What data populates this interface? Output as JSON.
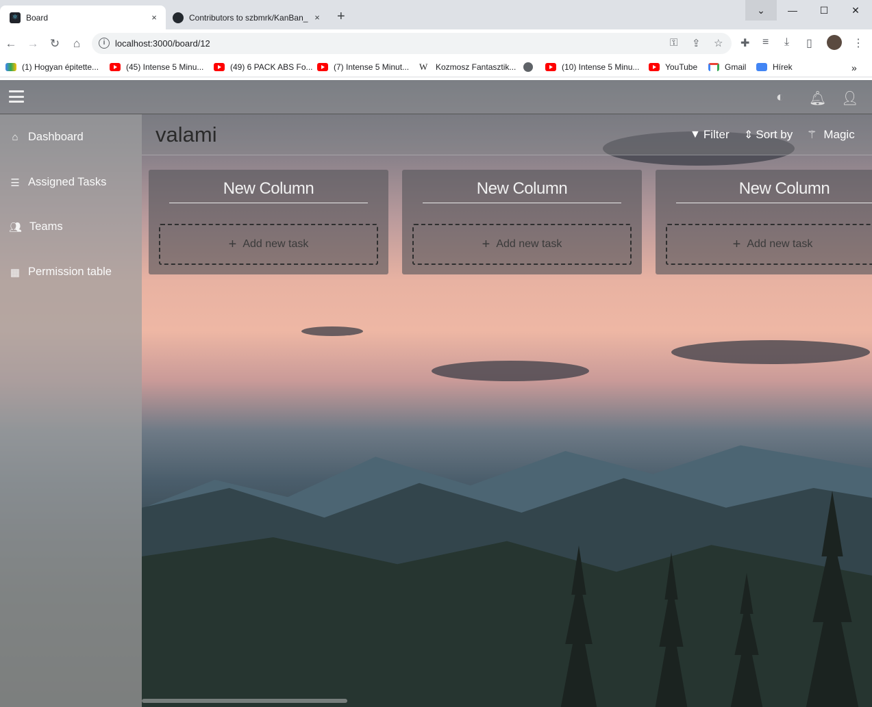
{
  "browser": {
    "tabs": [
      {
        "title": "Board",
        "close": "×"
      },
      {
        "title": "Contributors to szbmrk/KanBan_",
        "close": "×"
      }
    ],
    "new_tab": "+",
    "window_controls": {
      "dropdown": "⌄",
      "minimize": "—",
      "maximize": "☐",
      "close": "✕"
    },
    "url": "localhost:3000/board/12",
    "bookmarks": [
      {
        "label": "(1) Hogyan épitette...",
        "icon": "multicolor-icon"
      },
      {
        "label": "(45) Intense 5 Minu...",
        "icon": "youtube-icon"
      },
      {
        "label": "(49) 6 PACK ABS Fo...",
        "icon": "youtube-icon"
      },
      {
        "label": "(7) Intense 5 Minut...",
        "icon": "youtube-icon"
      },
      {
        "label": "Kozmosz Fantasztik...",
        "icon": "wikipedia-icon"
      },
      {
        "label": "",
        "icon": "globe-icon"
      },
      {
        "label": "(10) Intense 5 Minu...",
        "icon": "youtube-icon"
      },
      {
        "label": "YouTube",
        "icon": "youtube-icon"
      },
      {
        "label": "Gmail",
        "icon": "gmail-icon"
      },
      {
        "label": "Hírek",
        "icon": "google-news-icon"
      }
    ],
    "bookmarks_overflow": "»"
  },
  "sidebar": {
    "items": [
      {
        "label": "Dashboard",
        "icon": "home-icon"
      },
      {
        "label": "Assigned Tasks",
        "icon": "task-list-icon"
      },
      {
        "label": "Teams",
        "icon": "users-icon"
      },
      {
        "label": "Permission table",
        "icon": "table-icon"
      }
    ]
  },
  "board": {
    "title": "valami",
    "actions": {
      "filter": "Filter",
      "sort": "Sort by",
      "magic": "Magic"
    },
    "columns": [
      {
        "name": "New Column",
        "add_task": "Add new task"
      },
      {
        "name": "New Column",
        "add_task": "Add new task"
      },
      {
        "name": "New Column",
        "add_task": "Add new task"
      }
    ]
  }
}
